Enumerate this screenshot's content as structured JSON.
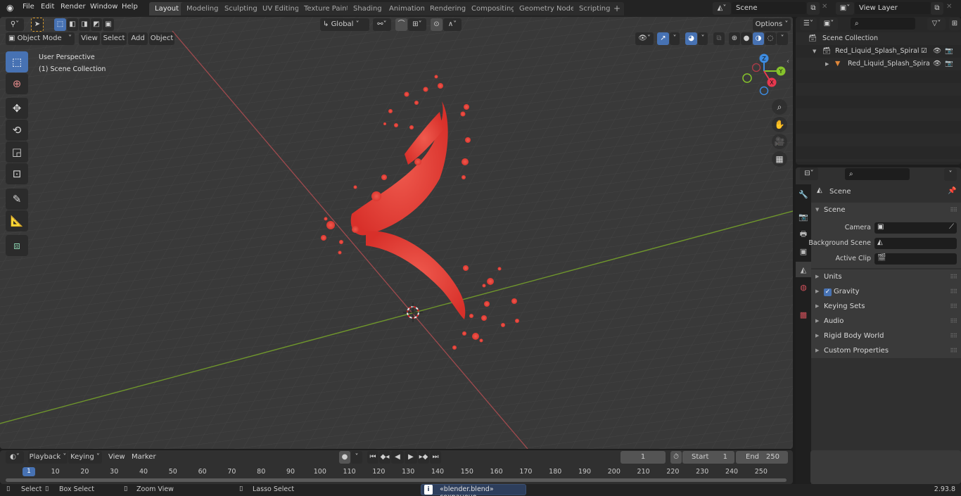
{
  "app": {
    "menu": [
      "File",
      "Edit",
      "Render",
      "Window",
      "Help"
    ],
    "workspaces": [
      "Layout",
      "Modeling",
      "Sculpting",
      "UV Editing",
      "Texture Paint",
      "Shading",
      "Animation",
      "Rendering",
      "Compositing",
      "Geometry Nodes",
      "Scripting"
    ],
    "active_workspace": "Layout",
    "add_workspace_icon": "+",
    "scene_selector": "Scene",
    "view_layer_selector": "View Layer",
    "version": "2.93.8"
  },
  "viewport": {
    "mode": "Object Mode",
    "header_menus": [
      "View",
      "Select",
      "Add",
      "Object"
    ],
    "orientation": "Global",
    "options_label": "Options",
    "overlay_title": "User Perspective",
    "overlay_subtitle": "(1) Scene Collection",
    "toolbar_tools": [
      "select-box",
      "cursor",
      "move",
      "rotate",
      "scale",
      "transform",
      "annotate",
      "measure",
      "add-cube"
    ],
    "active_tool": "select-box",
    "gizmo_axes": [
      "Z",
      "Y",
      "X"
    ],
    "axis_colors": {
      "x": "#e8384f",
      "y": "#86c32b",
      "z": "#3d8be0"
    },
    "object_color": "#e03a33"
  },
  "outliner": {
    "root": "Scene Collection",
    "items": [
      {
        "name": "Red_Liquid_Splash_Spiral",
        "type": "collection",
        "expanded": true,
        "checked": true
      },
      {
        "name": "Red_Liquid_Splash_Spira",
        "type": "mesh",
        "expanded": false
      }
    ]
  },
  "properties": {
    "context_title": "Scene",
    "section": "Scene",
    "fields": [
      {
        "label": "Camera",
        "value": ""
      },
      {
        "label": "Background Scene",
        "value": ""
      },
      {
        "label": "Active Clip",
        "value": ""
      }
    ],
    "panels": [
      {
        "label": "Units",
        "checkbox": false
      },
      {
        "label": "Gravity",
        "checkbox": true,
        "checked": true
      },
      {
        "label": "Keying Sets",
        "checkbox": false
      },
      {
        "label": "Audio",
        "checkbox": false
      },
      {
        "label": "Rigid Body World",
        "checkbox": false
      },
      {
        "label": "Custom Properties",
        "checkbox": false
      }
    ]
  },
  "timeline": {
    "menus": [
      "Playback",
      "Keying",
      "View",
      "Marker"
    ],
    "current_frame": "1",
    "start_label": "Start",
    "start": "1",
    "end_label": "End",
    "end": "250",
    "ruler": [
      "10",
      "20",
      "30",
      "40",
      "50",
      "60",
      "70",
      "80",
      "90",
      "100",
      "110",
      "120",
      "130",
      "140",
      "150",
      "160",
      "170",
      "180",
      "190",
      "200",
      "210",
      "220",
      "230",
      "240",
      "250"
    ]
  },
  "statusbar": {
    "hints": [
      "Select",
      "Box Select",
      "Zoom View",
      "Lasso Select"
    ],
    "message": "«blender.blend» сохранено"
  }
}
